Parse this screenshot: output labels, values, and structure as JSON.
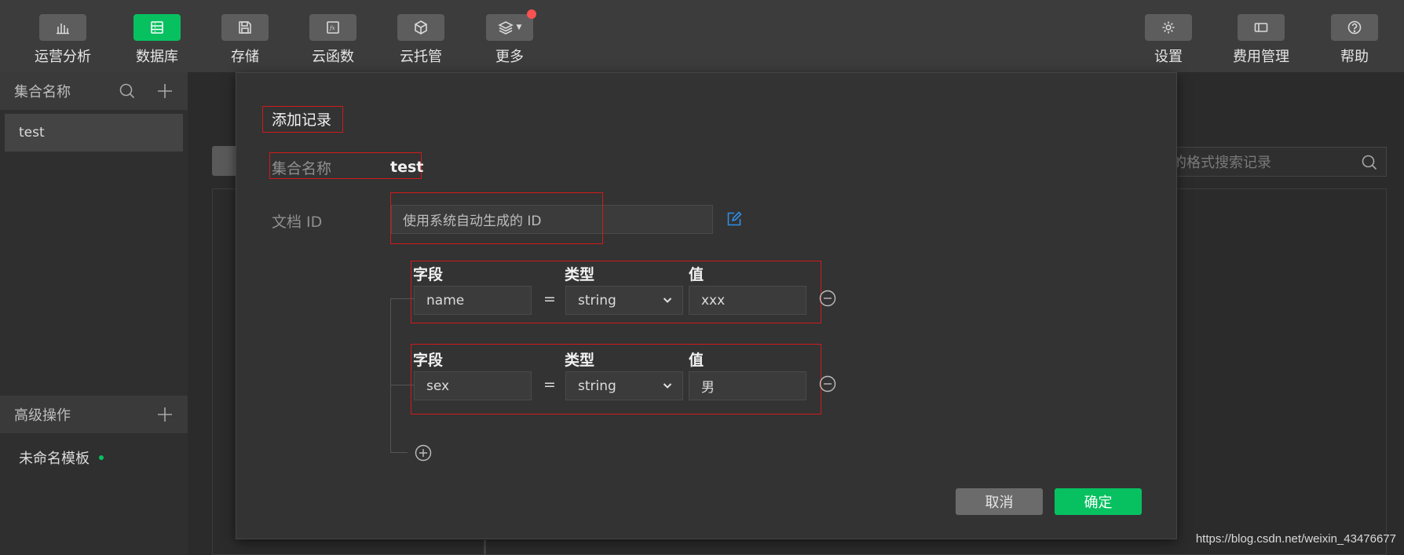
{
  "toolbar": {
    "left": [
      {
        "label": "运营分析",
        "icon": "bar-chart-icon"
      },
      {
        "label": "数据库",
        "icon": "database-icon",
        "active": true
      },
      {
        "label": "存储",
        "icon": "save-icon"
      },
      {
        "label": "云函数",
        "icon": "function-icon"
      },
      {
        "label": "云托管",
        "icon": "cube-icon"
      },
      {
        "label": "更多",
        "icon": "layers-icon",
        "badge": true
      }
    ],
    "right": [
      {
        "label": "设置",
        "icon": "gear-icon"
      },
      {
        "label": "费用管理",
        "icon": "billing-icon"
      },
      {
        "label": "帮助",
        "icon": "help-icon"
      }
    ]
  },
  "sidebar": {
    "collections_title": "集合名称",
    "collections": [
      "test"
    ],
    "advanced_title": "高级操作",
    "templates": [
      "未命名模板"
    ]
  },
  "background": {
    "search_placeholder": "的格式搜索记录"
  },
  "modal": {
    "title": "添加记录",
    "collection_label": "集合名称",
    "collection_value": "test",
    "doc_id_label": "文档 ID",
    "doc_id_placeholder": "使用系统自动生成的 ID",
    "column_field": "字段",
    "column_type": "类型",
    "column_value": "值",
    "equals": "=",
    "rows": [
      {
        "field": "name",
        "type": "string",
        "value": "xxx"
      },
      {
        "field": "sex",
        "type": "string",
        "value": "男"
      }
    ],
    "cancel": "取消",
    "confirm": "确定"
  },
  "watermark": "https://blog.csdn.net/weixin_43476677",
  "colors": {
    "accent": "#07c160",
    "annotation": "#d11a1a",
    "badge": "#fa5151",
    "edit": "#2e8fe6"
  }
}
